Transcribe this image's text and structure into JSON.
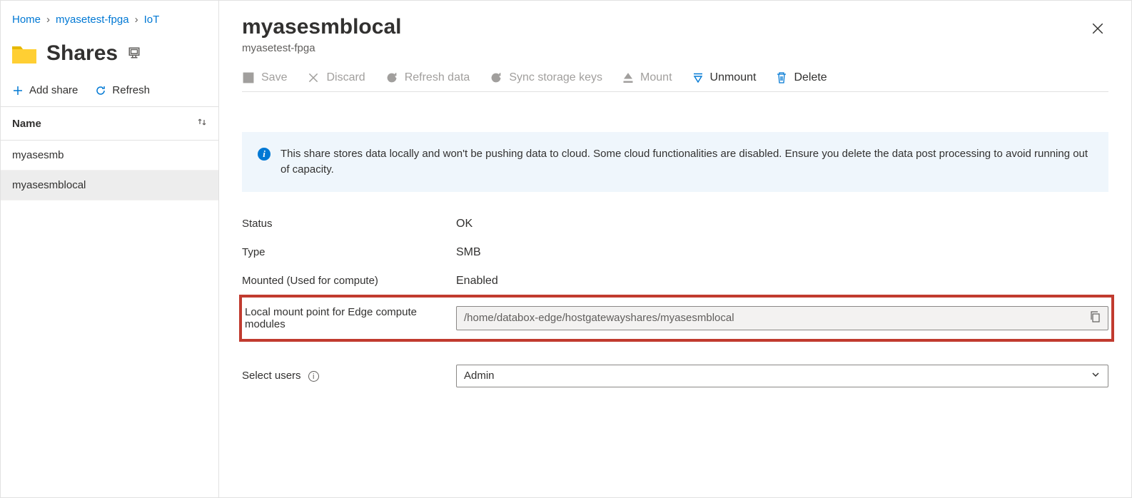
{
  "breadcrumb": {
    "home": "Home",
    "resource": "myasetest-fpga",
    "trailing": "IoT"
  },
  "left": {
    "title": "Shares",
    "add_share": "Add share",
    "refresh": "Refresh",
    "col_name": "Name",
    "items": [
      {
        "label": "myasesmb",
        "selected": false
      },
      {
        "label": "myasesmblocal",
        "selected": true
      }
    ]
  },
  "detail": {
    "title": "myasesmblocal",
    "subtitle": "myasetest-fpga",
    "toolbar": {
      "save": "Save",
      "discard": "Discard",
      "refresh_data": "Refresh data",
      "sync_keys": "Sync storage keys",
      "mount": "Mount",
      "unmount": "Unmount",
      "delete": "Delete"
    },
    "info": "This share stores data locally and won't be pushing data to cloud. Some cloud functionalities are disabled. Ensure you delete the data post processing to avoid running out of capacity.",
    "props": {
      "status_label": "Status",
      "status_value": "OK",
      "type_label": "Type",
      "type_value": "SMB",
      "mounted_label": "Mounted (Used for compute)",
      "mounted_value": "Enabled",
      "mount_point_label": "Local mount point for Edge compute modules",
      "mount_point_value": "/home/databox-edge/hostgatewayshares/myasesmblocal",
      "select_users_label": "Select users",
      "select_users_value": "Admin"
    }
  }
}
